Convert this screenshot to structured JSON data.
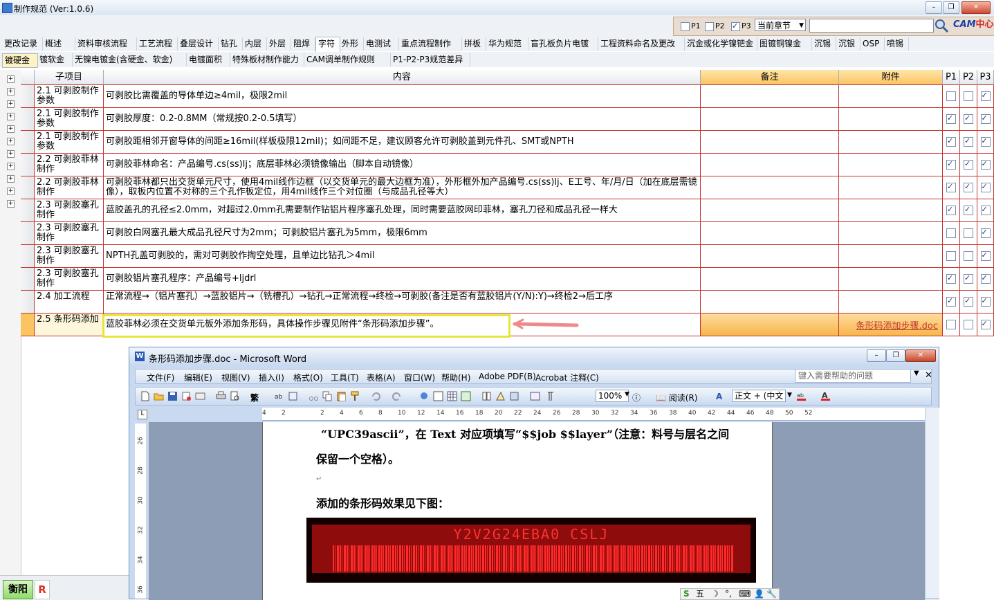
{
  "window": {
    "title": "制作规范 (Ver:1.0.6)"
  },
  "filter": {
    "p1": "P1",
    "p2": "P2",
    "p3": "P3",
    "p1_checked": false,
    "p2_checked": false,
    "p3_checked": true,
    "chapter_select": "当前章节"
  },
  "logo": {
    "text": "CAM",
    "text2": "中心"
  },
  "tabs_row1": [
    "更改记录",
    "概述",
    "资料审核流程",
    "工艺流程",
    "叠层设计",
    "钻孔",
    "内层",
    "外层",
    "阻焊",
    "字符",
    "外形",
    "电测试",
    "重点流程制作",
    "拼板",
    "华为规范",
    "盲孔板负片电镀",
    "工程资料命名及更改",
    "沉金或化学镍钯金",
    "图镀铜镍金",
    "沉锡",
    "沉银",
    "OSP",
    "喷锡"
  ],
  "tabs_row1_selected": "字符",
  "tabs_row2": [
    "镀硬金",
    "镀软金",
    "无镍电镀金(含硬金、软金)",
    "电镀面积",
    "特殊板材制作能力",
    "CAM调单制作规则",
    "P1-P2-P3规范差异"
  ],
  "tabs_row2_selected": "镀硬金",
  "grid": {
    "headers": {
      "sub": "子项目",
      "content": "内容",
      "remark": "备注",
      "attach": "附件",
      "p1": "P1",
      "p2": "P2",
      "p3": "P3"
    },
    "rows": [
      {
        "sub": "2.1 可剥胶制作参数",
        "content": "可剥胶比需覆盖的导体单边≥4mil，极限2mil",
        "attach": "",
        "p": [
          false,
          false,
          true
        ]
      },
      {
        "sub": "2.1 可剥胶制作参数",
        "content": "可剥胶厚度：0.2-0.8MM（常规按0.2-0.5填写）",
        "attach": "",
        "p": [
          true,
          true,
          true
        ]
      },
      {
        "sub": "2.1 可剥胶制作参数",
        "content": "可剥胶距相邻开窗导体的间距≥16mil(样板极限12mil)；如间距不足，建议顾客允许可剥胶盖到元件孔、SMT或NPTH",
        "attach": "",
        "p": [
          true,
          true,
          true
        ]
      },
      {
        "sub": "2.2 可剥胶菲林制作",
        "content": "可剥胶菲林命名：产品编号.cs(ss)lj；底层菲林必须镜像输出（脚本自动镜像）",
        "attach": "",
        "p": [
          true,
          true,
          true
        ]
      },
      {
        "sub": "2.2 可剥胶菲林制作",
        "content": "可剥胶菲林都只出交货单元尺寸，使用4mil线作边框（以交货单元的最大边框为准），外形框外加产品编号.cs(ss)lj、E工号、年/月/日（加在底层需镜像），取板内位置不对称的三个孔作板定位，用4mil线作三个对位圈（与成品孔径等大）",
        "attach": "",
        "p": [
          true,
          true,
          true
        ]
      },
      {
        "sub": "2.3 可剥胶塞孔制作",
        "content": "蓝胶盖孔的孔径≤2.0mm，对超过2.0mm孔需要制作钻铝片程序塞孔处理，同时需要蓝胶网印菲林，塞孔刀径和成品孔径一样大",
        "attach": "",
        "p": [
          true,
          true,
          true
        ]
      },
      {
        "sub": "2.3 可剥胶塞孔制作",
        "content": "可剥胶白网塞孔最大成品孔径尺寸为2mm；可剥胶铝片塞孔为5mm，极限6mm",
        "attach": "",
        "p": [
          false,
          false,
          true
        ]
      },
      {
        "sub": "2.3 可剥胶塞孔制作",
        "content": "NPTH孔盖可剥胶的，需对可剥胶作掏空处理，且单边比钻孔＞4mil",
        "attach": "",
        "p": [
          false,
          false,
          true
        ]
      },
      {
        "sub": "2.3 可剥胶塞孔制作",
        "content": "可剥胶铝片塞孔程序：产品编号+ljdrl",
        "attach": "",
        "p": [
          true,
          true,
          true
        ]
      },
      {
        "sub": "2.4 加工流程",
        "content": "正常流程→（铝片塞孔）→蓝胶铝片→（铣槽孔）→钻孔→正常流程→终检→可剥胶(备注是否有蓝胶铝片(Y/N):Y)→终检2→后工序",
        "attach": "",
        "p": [
          true,
          true,
          true
        ]
      },
      {
        "sub": "2.5 条形码添加",
        "content": "蓝胶菲林必须在交货单元板外添加条形码，具体操作步骤见附件“条形码添加步骤”。",
        "attach": "条形码添加步骤.doc",
        "p": [
          false,
          false,
          true
        ]
      }
    ]
  },
  "bottom": {
    "btn1": "衡阳",
    "btn2": "R"
  },
  "word": {
    "title": "条形码添加步骤.doc - Microsoft Word",
    "menu": [
      "文件(F)",
      "编辑(E)",
      "视图(V)",
      "插入(I)",
      "格式(O)",
      "工具(T)",
      "表格(A)",
      "窗口(W)",
      "帮助(H)",
      "Adobe PDF(B)",
      "Acrobat 注释(C)"
    ],
    "help_placeholder": "键入需要帮助的问题",
    "zoom": "100%",
    "read": "阅读(R)",
    "style": "正文 + (中文",
    "trad": "繁",
    "ruler_h": [
      "4",
      "2",
      "2",
      "4",
      "6",
      "8",
      "10",
      "12",
      "14",
      "16",
      "18",
      "20",
      "22",
      "24",
      "26",
      "28",
      "30",
      "32",
      "34",
      "36",
      "38",
      "40",
      "42",
      "44",
      "46",
      "48",
      "50",
      "52"
    ],
    "ruler_v": [
      "26",
      "28",
      "30",
      "32",
      "34",
      "36"
    ],
    "line1": "“UPC39ascii”，在 Text 对应项填写“$$job $$layer”（注意：料号与层名之间",
    "line2": "保留一个空格）。",
    "line3": "添加的条形码效果见下图：",
    "barcode_text": "Y2V2G24EBA0 CSLJ",
    "ime": "五"
  },
  "colors": {
    "grid_line": "#c2352e",
    "remark_header": "#fbc463",
    "highlight": "#e8e53a",
    "link": "#c0392b"
  }
}
